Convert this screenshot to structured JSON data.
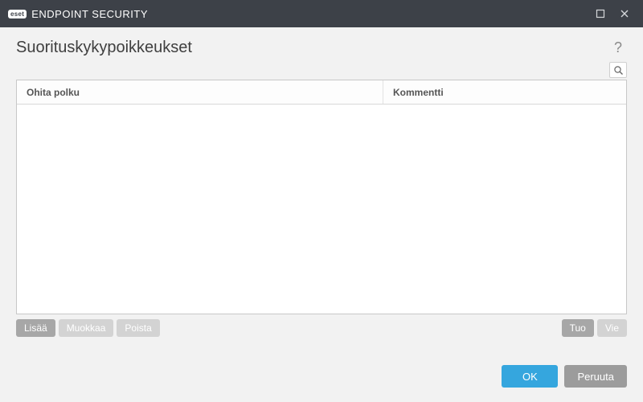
{
  "titlebar": {
    "logo_badge": "eset",
    "app_name": "ENDPOINT SECURITY"
  },
  "header": {
    "title": "Suorituskykypoikkeukset"
  },
  "table": {
    "columns": {
      "path": "Ohita polku",
      "comment": "Kommentti"
    }
  },
  "actions": {
    "add": "Lisää",
    "edit": "Muokkaa",
    "delete": "Poista",
    "import": "Tuo",
    "export": "Vie"
  },
  "footer": {
    "ok": "OK",
    "cancel": "Peruuta"
  }
}
